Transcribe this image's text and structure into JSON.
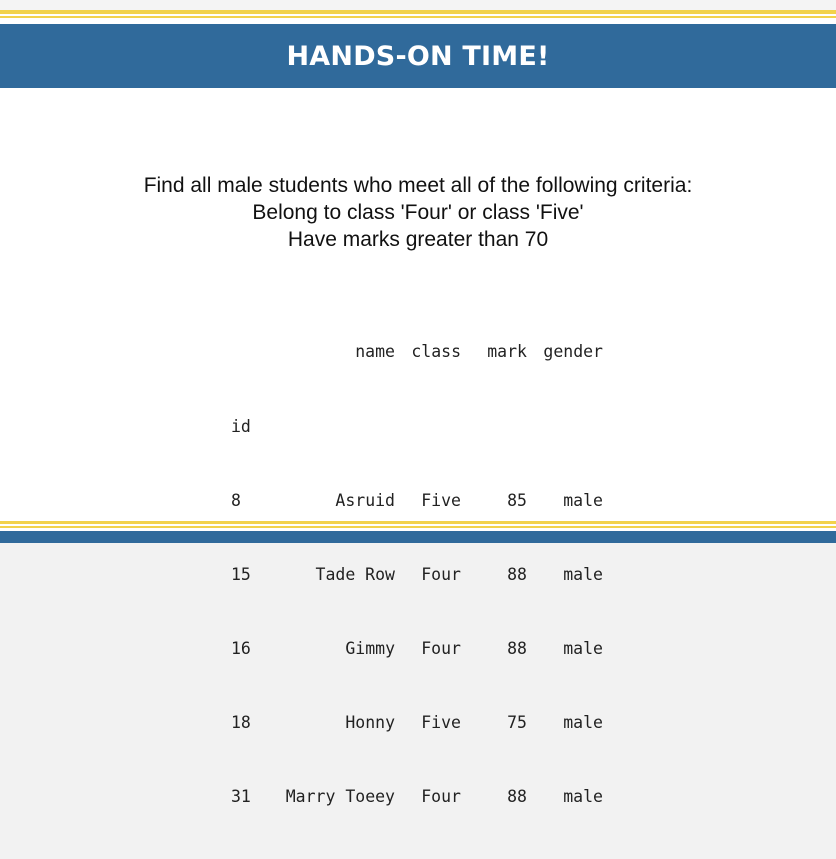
{
  "header": {
    "title": "HANDS-ON TIME!"
  },
  "body": {
    "lines": [
      "Find all male students who meet all of the following criteria:",
      "Belong to class 'Four' or class 'Five'",
      "Have marks greater than 70"
    ]
  },
  "table": {
    "columns": [
      "name",
      "class",
      "mark",
      "gender"
    ],
    "index_name": "id",
    "rows": [
      {
        "id": "8",
        "name": "Asruid",
        "class": "Five",
        "mark": "85",
        "gender": "male"
      },
      {
        "id": "15",
        "name": "Tade Row",
        "class": "Four",
        "mark": "88",
        "gender": "male"
      },
      {
        "id": "16",
        "name": "Gimmy",
        "class": "Four",
        "mark": "88",
        "gender": "male"
      },
      {
        "id": "18",
        "name": "Honny",
        "class": "Five",
        "mark": "75",
        "gender": "male"
      },
      {
        "id": "31",
        "name": "Marry Toeey",
        "class": "Four",
        "mark": "88",
        "gender": "male"
      }
    ]
  },
  "colors": {
    "header_blue": "#306a9b",
    "accent_gold": "#f2d24b"
  }
}
